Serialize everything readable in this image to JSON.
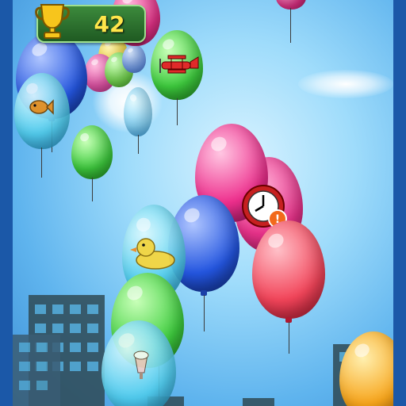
{
  "hud": {
    "score": "42",
    "trophy_icon": "trophy-icon",
    "frame_color": "#1b58a8",
    "accent_color": "#ffe64a"
  },
  "balloons": [
    {
      "name": "pink",
      "color": "#e8328a"
    },
    {
      "name": "blue",
      "color": "#2456e0"
    },
    {
      "name": "green",
      "color": "#3fcf3f"
    },
    {
      "name": "red",
      "color": "#f2455a"
    },
    {
      "name": "cyan",
      "color": "#3fc4ef"
    },
    {
      "name": "orange",
      "color": "#f7a51c"
    }
  ],
  "powerups": [
    "airplane-icon",
    "rubber-duck-icon",
    "alarm-clock-icon",
    "fish-icon",
    "milkshake-icon"
  ]
}
